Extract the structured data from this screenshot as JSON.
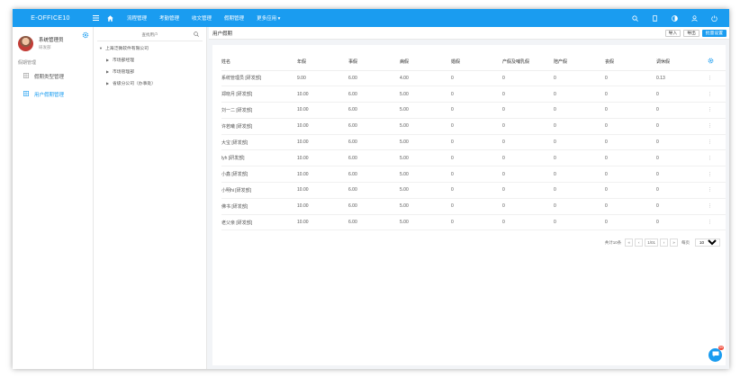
{
  "topbar": {
    "brand": "E-OFFICE10",
    "menu": [
      "流程管理",
      "考勤管理",
      "收文管理",
      "假期管理",
      "更多应用 ▾"
    ]
  },
  "sidebar": {
    "user_name": "系统管理员",
    "user_dept": "研发部",
    "section": "假期管理",
    "items": [
      "假期类型管理",
      "用户假期管理"
    ]
  },
  "tree": {
    "search_placeholder": "查找用户",
    "root": "上海泛微软件有限公司",
    "nodes": [
      "市场部经理",
      "市场管理部",
      "省级分公司（办事处）"
    ]
  },
  "main": {
    "title": "用户假期",
    "buttons": [
      "导入",
      "导出",
      "批量设置"
    ]
  },
  "table": {
    "columns": [
      "姓名",
      "年假",
      "事假",
      "病假",
      "婚假",
      "产假及哺乳假",
      "陪产假",
      "丧假",
      "调休假"
    ],
    "rows": [
      [
        "系统管理员 [研发部]",
        "9.00",
        "6.00",
        "4.00",
        "0",
        "0",
        "0",
        "0",
        "0.13"
      ],
      [
        "郑晓月 [研发部]",
        "10.00",
        "6.00",
        "5.00",
        "0",
        "0",
        "0",
        "0",
        "0"
      ],
      [
        "刘一二 [研发部]",
        "10.00",
        "6.00",
        "5.00",
        "0",
        "0",
        "0",
        "0",
        "0"
      ],
      [
        "许若曦 [研发部]",
        "10.00",
        "6.00",
        "5.00",
        "0",
        "0",
        "0",
        "0",
        "0"
      ],
      [
        "大宝 [研发部]",
        "10.00",
        "6.00",
        "5.00",
        "0",
        "0",
        "0",
        "0",
        "0"
      ],
      [
        "lyh [研发部]",
        "10.00",
        "6.00",
        "5.00",
        "0",
        "0",
        "0",
        "0",
        "0"
      ],
      [
        "小鑫 [研发部]",
        "10.00",
        "6.00",
        "5.00",
        "0",
        "0",
        "0",
        "0",
        "0"
      ],
      [
        "小明hi [研发部]",
        "10.00",
        "6.00",
        "5.00",
        "0",
        "0",
        "0",
        "0",
        "0"
      ],
      [
        "佛书 [研发部]",
        "10.00",
        "6.00",
        "5.00",
        "0",
        "0",
        "0",
        "0",
        "0"
      ],
      [
        "老父亲 [研发部]",
        "10.00",
        "6.00",
        "5.00",
        "0",
        "0",
        "0",
        "0",
        "0"
      ]
    ]
  },
  "pager": {
    "total": "共计10条",
    "page": "1/01",
    "per_page_label": "每页",
    "per_page": "10"
  },
  "chat": {
    "badge": "99"
  },
  "colors": {
    "accent": "#1a9cf0",
    "badge": "#f04e3e"
  }
}
